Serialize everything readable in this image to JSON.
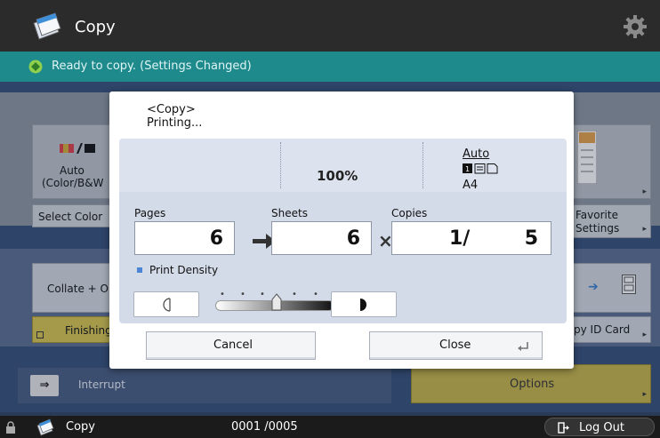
{
  "header": {
    "title": "Copy"
  },
  "status": {
    "text": "Ready to copy. (Settings Changed)"
  },
  "background": {
    "color_tile": {
      "label_line1": "Auto",
      "label_line2": "(Color/B&W"
    },
    "select_color_label": "Select Color",
    "favorite_line1": "Favorite",
    "favorite_line2": "Settings",
    "collate_label": "Collate + O",
    "finishing_label": "Finishing",
    "id_card_label": "py ID Card",
    "interrupt_label": "Interrupt",
    "options_label": "Options"
  },
  "dialog": {
    "title_line1": "<Copy>",
    "title_line2": "Printing...",
    "zoom": "100%",
    "paper_source": "Auto",
    "paper_size": "A4",
    "pages_label": "Pages",
    "pages_value": "6",
    "sheets_label": "Sheets",
    "sheets_value": "6",
    "copies_label": "Copies",
    "copies_current": "1/",
    "copies_total": "5",
    "density_label": "Print Density",
    "density_level": 0.5,
    "cancel_label": "Cancel",
    "close_label": "Close"
  },
  "footer": {
    "app_label": "Copy",
    "counter": "0001 /0005",
    "logout_label": "Log Out"
  },
  "colors": {
    "teal_status": "#1f8a8c",
    "options_yellow": "#c8b64a",
    "dark_header": "#2b2b2b"
  }
}
